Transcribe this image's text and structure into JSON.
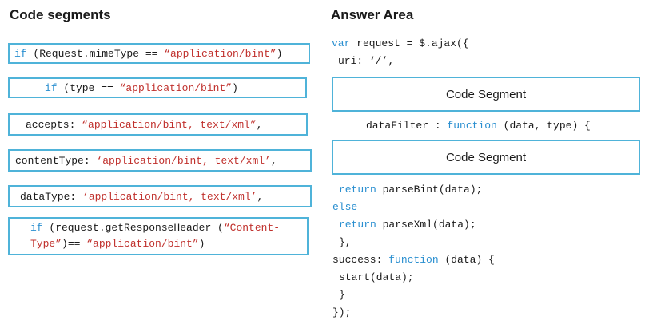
{
  "left": {
    "heading": "Code segments",
    "segments": [
      {
        "kw1": "if ",
        "p1": "(Request.mimeType == ",
        "s1": "“application/bint”",
        "p2": ")"
      },
      {
        "kw1": "if ",
        "p1": "(type == ",
        "s1": "“application/bint”",
        "p2": ")"
      },
      {
        "p1": "accepts: ",
        "s1": "“application/bint, text/xml”",
        "p2": ","
      },
      {
        "p1": "contentType: ",
        "s1": "‘application/bint, text/xml’",
        "p2": ","
      },
      {
        "p1": "dataType: ",
        "s1": "‘application/bint, text/xml’",
        "p2": ","
      },
      {
        "kw1": "if ",
        "p1": "(request.getResponseHeader (",
        "s1": "“Content-",
        "s2": "Type”",
        "p2": ")== ",
        "s3": "“application/bint”",
        "p3": ")"
      }
    ]
  },
  "right": {
    "heading": "Answer Area",
    "line1_kw": "var",
    "line1_rest": " request = $.ajax({",
    "line2": "uri: ‘/’,",
    "slot1": "Code Segment",
    "line3_a": "dataFilter : ",
    "line3_kw": "function",
    "line3_b": " (data, type) {",
    "slot2": "Code Segment",
    "ret1_kw": "return",
    "ret1_rest": " parseBint(data);",
    "else_kw": "else",
    "ret2_kw": "return",
    "ret2_rest": " parseXml(data);",
    "close1": "},",
    "succ_a": "success: ",
    "succ_kw": "function",
    "succ_b": " (data) {",
    "start": "start(data);",
    "close2": "}",
    "close3": "});"
  }
}
